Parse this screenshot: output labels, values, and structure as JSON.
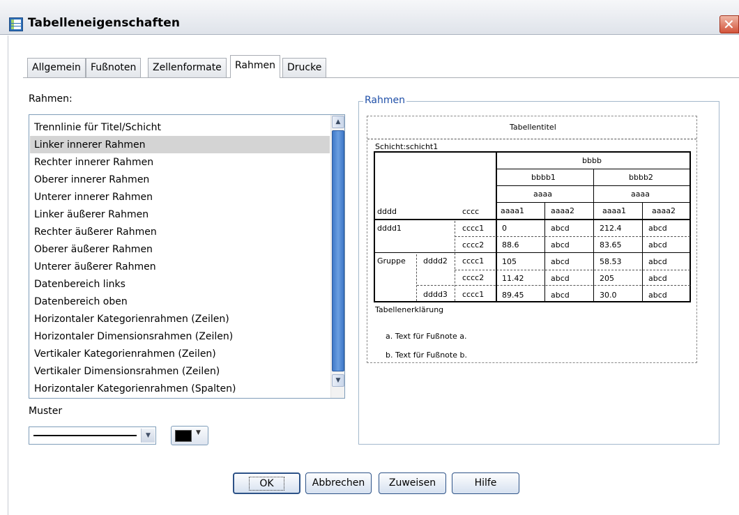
{
  "window": {
    "title": "Tabelleneigenschaften"
  },
  "tabs": [
    "Allgemein",
    "Fußnoten",
    "Zellenformate",
    "Rahmen",
    "Drucke"
  ],
  "left": {
    "list_label": "Rahmen:",
    "items": [
      "Trennlinie für Titel/Schicht",
      "Linker innerer Rahmen",
      "Rechter innerer Rahmen",
      "Oberer innerer Rahmen",
      "Unterer innerer Rahmen",
      "Linker äußerer Rahmen",
      "Rechter äußerer Rahmen",
      "Oberer äußerer Rahmen",
      "Unterer äußerer Rahmen",
      "Datenbereich links",
      "Datenbereich oben",
      "Horizontaler Kategorienrahmen (Zeilen)",
      "Horizontaler Dimensionsrahmen (Zeilen)",
      "Vertikaler Kategorienrahmen (Zeilen)",
      "Vertikaler Dimensionsrahmen (Zeilen)",
      "Horizontaler Kategorienrahmen (Spalten)"
    ],
    "selected_index": 1,
    "pattern_label": "Muster",
    "color_value": "#000000"
  },
  "preview": {
    "group_title": "Rahmen",
    "table_title": "Tabellentitel",
    "layer": "Schicht:schicht1",
    "col_top": "bbbb",
    "col_b1": "bbbb1",
    "col_b2": "bbbb2",
    "col_a_left": "aaaa",
    "col_a_right": "aaaa",
    "row_dim": "dddd",
    "row_dim2": "cccc",
    "col_leaves": [
      "aaaa1",
      "aaaa2",
      "aaaa1",
      "aaaa2"
    ],
    "rows": [
      {
        "g": "dddd1",
        "sub": "",
        "c": "cccc1",
        "v": [
          "0",
          "abcd",
          "212.4",
          "abcd"
        ]
      },
      {
        "g": "",
        "sub": "",
        "c": "cccc2",
        "v": [
          "88.6",
          "abcd",
          "83.65",
          "abcd"
        ]
      },
      {
        "g": "Gruppe",
        "sub": "dddd2",
        "c": "cccc1",
        "v": [
          "105",
          "abcd",
          "58.53",
          "abcd"
        ]
      },
      {
        "g": "",
        "sub": "",
        "c": "cccc2",
        "v": [
          "11.42",
          "abcd",
          "205",
          "abcd"
        ]
      },
      {
        "g": "",
        "sub": "dddd3",
        "c": "cccc1",
        "v": [
          "89.45",
          "abcd",
          "30.0",
          "abcd"
        ]
      }
    ],
    "caption": "Tabellenerklärung",
    "footnote_a": "a. Text für Fußnote a.",
    "footnote_b": "b. Text für Fußnote b."
  },
  "buttons": {
    "ok": "OK",
    "cancel": "Abbrechen",
    "apply": "Zuweisen",
    "help": "Hilfe"
  }
}
